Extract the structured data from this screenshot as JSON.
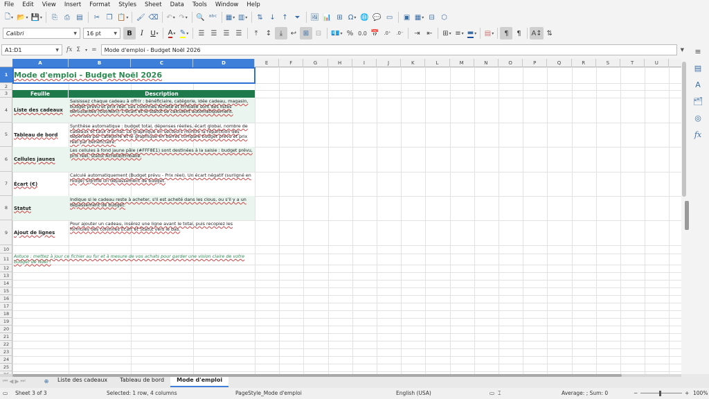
{
  "menu": [
    "File",
    "Edit",
    "View",
    "Insert",
    "Format",
    "Styles",
    "Sheet",
    "Data",
    "Tools",
    "Window",
    "Help"
  ],
  "toolbar": {
    "font_name": "Calibri",
    "font_size": "16 pt",
    "bold": "B",
    "italic": "I",
    "underline": "U",
    "font_color": "A",
    "percent": "%",
    "decimals": "0.0"
  },
  "formula": {
    "cell_ref": "A1:D1",
    "sum_symbol": "Σ",
    "equals": "=",
    "content": "Mode d'emploi - Budget Noël 2026"
  },
  "columns": [
    "A",
    "B",
    "C",
    "D",
    "E",
    "F",
    "G",
    "H",
    "I",
    "J",
    "K",
    "L",
    "M",
    "N",
    "O",
    "P",
    "Q",
    "R",
    "S",
    "T",
    "U"
  ],
  "rows": [
    "1",
    "2",
    "3",
    "4",
    "5",
    "6",
    "7",
    "8",
    "9",
    "10",
    "11",
    "12",
    "13",
    "14",
    "15",
    "16",
    "17",
    "18",
    "19",
    "20",
    "21",
    "22",
    "23",
    "24",
    "25",
    "26"
  ],
  "sheet": {
    "title": "Mode d'emploi - Budget Noël 2026",
    "header_feuille": "Feuille",
    "header_description": "Description",
    "entries": [
      {
        "feuille": "Liste des cadeaux",
        "description": "Saisissez chaque cadeau à offrir : bénéficiaire, catégorie, idée cadeau, magasin, budget prévu et prix réel. Les colonnes Acheté et Emballé sont des listes déroulantes (Oui/Non). L'écart et le statut se calculent automatiquement."
      },
      {
        "feuille": "Tableau de bord",
        "description": "Synthèse automatique : budget total, dépenses réelles, écart global, nombre de cadeaux et taux d'achat. Le graphique en secteurs montre la répartition des dépenses par catégorie et le graphique en barres compare budget prévu et prix réel par bénéficiaire."
      },
      {
        "feuille": "Cellules jaunes",
        "description": "Les cellules à fond jaune pâle (#FFF8E1) sont destinées à la saisie : budget prévu, prix réel, statut Acheté/Emballé."
      },
      {
        "feuille": "Écart (€)",
        "description": "Calculé automatiquement (Budget prévu - Prix réel). Un écart négatif (surligné en rouge) signifie un dépassement de budget."
      },
      {
        "feuille": "Statut",
        "description": "Indique si le cadeau reste à acheter, s'il est acheté dans les clous, ou s'il y a un dépassement de budget."
      },
      {
        "feuille": "Ajout de lignes",
        "description": "Pour ajouter un cadeau, insérez une ligne avant le total, puis recopiez les formules des colonnes Écart et Statut vers le bas."
      }
    ],
    "tip": "Astuce : mettez à jour ce fichier au fur et à mesure de vos achats pour garder une vision claire de votre budget de Noël !"
  },
  "tabs": [
    "Liste des cadeaux",
    "Tableau de bord",
    "Mode d'emploi"
  ],
  "active_tab": "Mode d'emploi",
  "status": {
    "sheet": "Sheet 3 of 3",
    "selection": "Selected: 1 row, 4 columns",
    "page_style": "PageStyle_Mode d'emploi",
    "language": "English (USA)",
    "stats": "Average: ; Sum: 0",
    "zoom": "100%"
  },
  "colors": {
    "header_green": "#1E7A4A",
    "title_green": "#2A8A50",
    "band": "#E9F5EE",
    "selection": "#3D7FD9"
  }
}
